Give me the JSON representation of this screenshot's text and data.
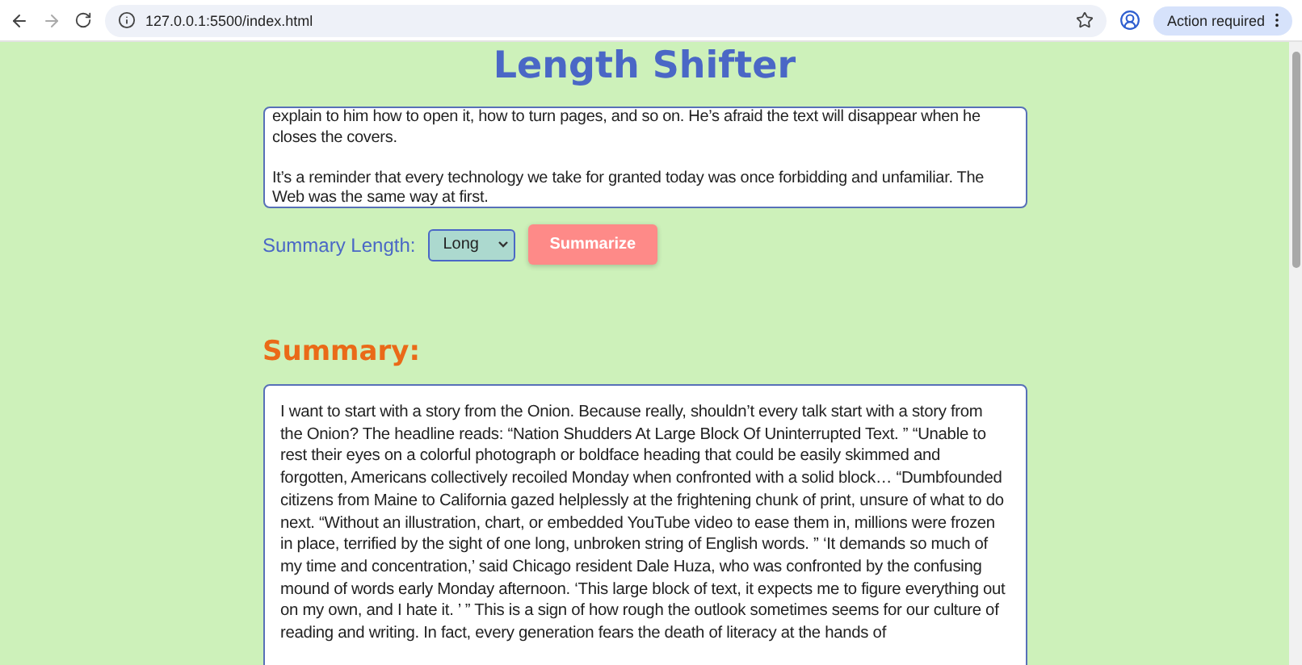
{
  "browser": {
    "url": "127.0.0.1:5500/index.html",
    "action_label": "Action required"
  },
  "page": {
    "title": "Length Shifter",
    "input": {
      "value": "explain to him how to open it, how to turn pages, and so on. He’s afraid the text will disappear when he closes the covers.\n\nIt’s a reminder that every technology we take for granted today was once forbidding and unfamiliar. The Web was the same way at first."
    },
    "length_label": "Summary Length:",
    "length_value": "Long",
    "button": "Summarize",
    "summary_heading": "Summary:",
    "summary": "I want to start with a story from the Onion. Because really, shouldn’t every talk start with a story from the Onion? The headline reads: “Nation Shudders At Large Block Of Uninterrupted Text. ” “Unable to rest their eyes on a colorful photograph or boldface heading that could be easily skimmed and forgotten, Americans collectively recoiled Monday when confronted with a solid block… “Dumbfounded citizens from Maine to California gazed helplessly at the frightening chunk of print, unsure of what to do next. “Without an illustration, chart, or embedded YouTube video to ease them in, millions were frozen in place, terrified by the sight of one long, unbroken string of English words. ” ‘It demands so much of my time and concentration,’ said Chicago resident Dale Huza, who was confronted by the confusing mound of words early Monday afternoon. ‘This large block of text, it expects me to figure everything out on my own, and I hate it. ’ ” This is a sign of how rough the outlook sometimes seems for our culture of reading and writing. In fact, every generation fears the death of literacy at the hands of"
  }
}
